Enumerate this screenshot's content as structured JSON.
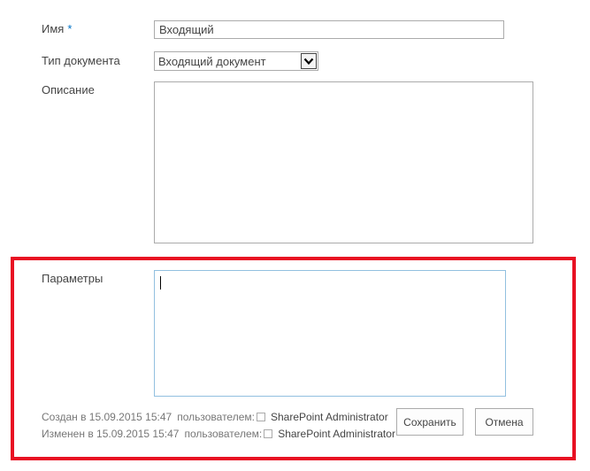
{
  "form": {
    "name": {
      "label": "Имя",
      "required_mark": "*",
      "value": "Входящий"
    },
    "document_type": {
      "label": "Тип документа",
      "selected": "Входящий документ"
    },
    "description": {
      "label": "Описание",
      "value": ""
    },
    "parameters": {
      "label": "Параметры",
      "value": ""
    }
  },
  "meta": {
    "created": {
      "text": "Создан в 15.09.2015 15:47",
      "by_label": "пользователем:",
      "user": "SharePoint Administrator"
    },
    "modified": {
      "text": "Изменен в 15.09.2015 15:47",
      "by_label": "пользователем:",
      "user": "SharePoint Administrator"
    }
  },
  "buttons": {
    "save": "Сохранить",
    "cancel": "Отмена"
  },
  "colors": {
    "highlight": "#e81123",
    "required": "#0072c6",
    "focus_border": "#92c0e0"
  },
  "icons": {
    "dropdown": "chevron-down-icon",
    "presence": "presence-icon"
  }
}
